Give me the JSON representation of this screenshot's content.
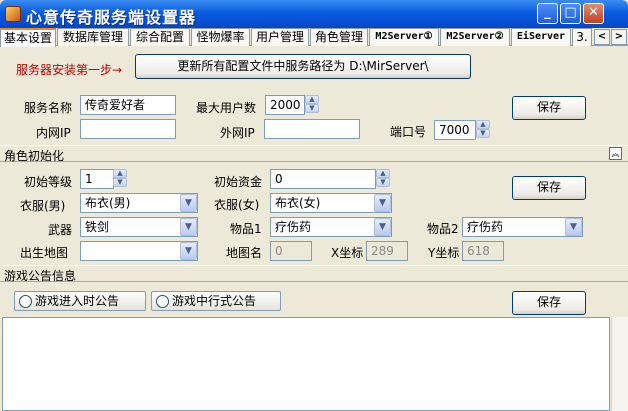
{
  "window": {
    "title": "心意传奇服务端设置器",
    "minimize": "_",
    "maximize": "□",
    "close": "✕"
  },
  "tabs": [
    "基本设置",
    "数据库管理",
    "综合配置",
    "怪物爆率",
    "用户管理",
    "角色管理",
    "M2Server①",
    "M2Server②",
    "EiServer",
    "3."
  ],
  "tab_nav": {
    "left": "<",
    "right": ">"
  },
  "install": {
    "step_label": "服务器安装第一步→",
    "update_button": "更新所有配置文件中服务路径为 D:\\MirServer\\"
  },
  "server": {
    "name_label": "服务名称",
    "name_value": "传奇爱好者",
    "max_users_label": "最大用户数",
    "max_users_value": "2000",
    "inner_ip_label": "内网IP",
    "inner_ip_value": "",
    "outer_ip_label": "外网IP",
    "outer_ip_value": "",
    "port_label": "端口号",
    "port_value": "7000",
    "save_label": "保存"
  },
  "role": {
    "section_title": "角色初始化",
    "collapse_glyph": "︽",
    "level_label": "初始等级",
    "level_value": "1",
    "gold_label": "初始资金",
    "gold_value": "0",
    "male_cloth_label": "衣服(男)",
    "male_cloth_value": "布衣(男)",
    "female_cloth_label": "衣服(女)",
    "female_cloth_value": "布衣(女)",
    "weapon_label": "武器",
    "weapon_value": "铁剑",
    "item1_label": "物品1",
    "item1_value": "疗伤药",
    "item2_label": "物品2",
    "item2_value": "疗伤药",
    "birth_map_label": "出生地图",
    "birth_map_value": "",
    "map_name_label": "地图名",
    "map_name_value": "0",
    "x_label": "X坐标",
    "x_value": "289",
    "y_label": "Y坐标",
    "y_value": "618",
    "save_label": "保存"
  },
  "notice": {
    "section_title": "游戏公告信息",
    "radio_enter": "游戏进入时公告",
    "radio_running": "游戏中行式公告",
    "save_label": "保存"
  }
}
